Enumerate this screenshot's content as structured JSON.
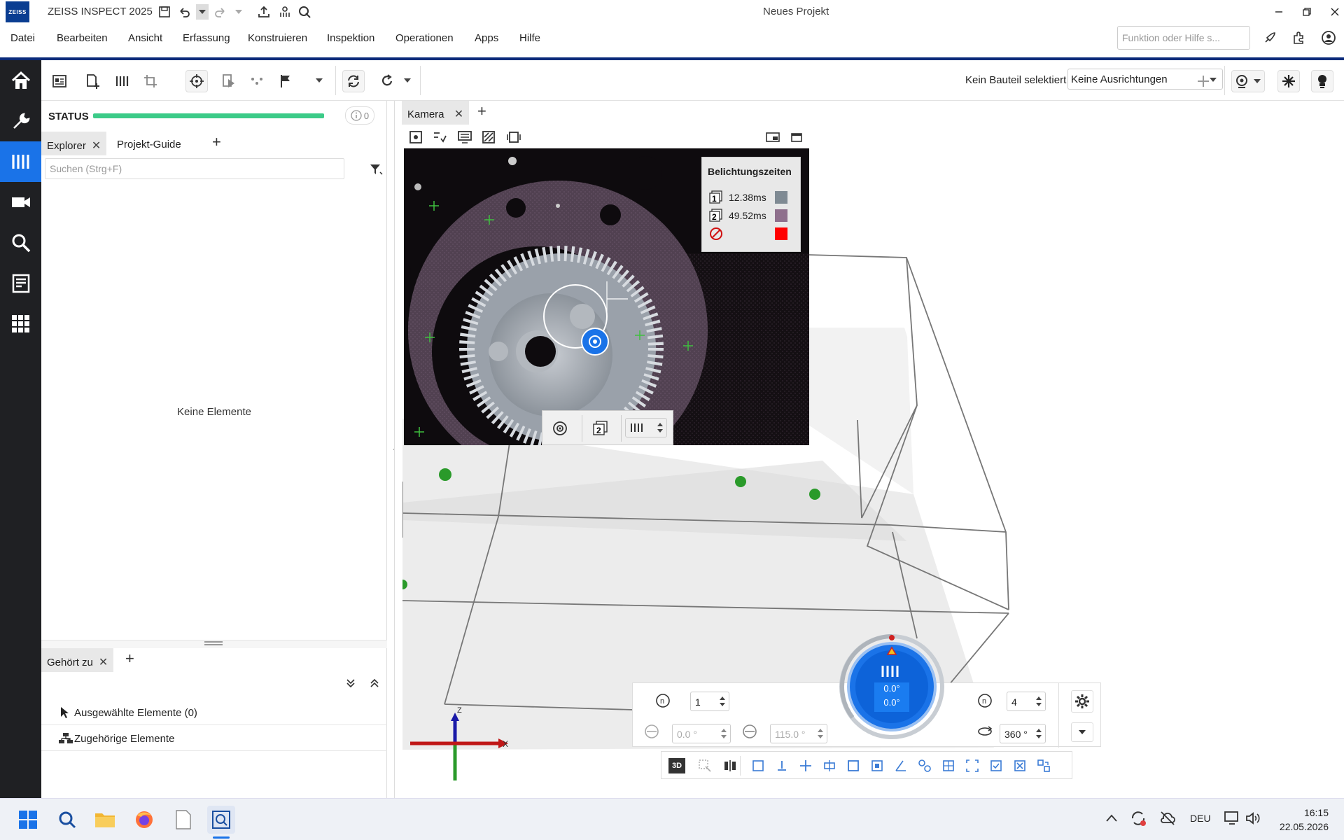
{
  "app": {
    "logo": "ZEISS",
    "title": "ZEISS INSPECT 2025",
    "document_title": "Neues Projekt"
  },
  "menu": {
    "items": [
      "Datei",
      "Bearbeiten",
      "Ansicht",
      "Erfassung",
      "Konstruieren",
      "Inspektion",
      "Operationen",
      "Apps",
      "Hilfe"
    ],
    "search_placeholder": "Funktion oder Hilfe s..."
  },
  "toolbar": {
    "part_status": "Kein Bauteil selektiert",
    "alignment": "Keine Ausrichtungen"
  },
  "left_panel": {
    "status_label": "STATUS",
    "status_progress": 1.0,
    "info_count": "0",
    "tabs": [
      "Explorer",
      "Projekt-Guide"
    ],
    "search_placeholder": "Suchen (Strg+F)",
    "empty_text": "Keine Elemente",
    "bottom_tab": "Gehört zu",
    "related_rows": [
      "Ausgewählte Elemente (0)",
      "Zugehörige Elemente"
    ]
  },
  "camera": {
    "tab": "Kamera",
    "exposure": {
      "title": "Belichtungszeiten",
      "rows": [
        {
          "index": "1",
          "value": "12.38ms",
          "color": "#7f8a93"
        },
        {
          "index": "2",
          "value": "49.52ms",
          "color": "#8e6f8c"
        },
        {
          "index": "",
          "value": "",
          "color": "#ff0000"
        }
      ]
    },
    "scan_stepper": ""
  },
  "controls": {
    "steps_value": "1",
    "angle_start": "0.0 °",
    "angle_end": "115.0 °",
    "count_value": "4",
    "rotation_range": "360 °",
    "dial_value_1": "0.0°",
    "dial_value_2": "0.0°"
  },
  "axes": {
    "x": "X",
    "z": "Z"
  },
  "taskbar": {
    "language": "DEU",
    "time": "16:15",
    "date": "22.05.2026"
  }
}
